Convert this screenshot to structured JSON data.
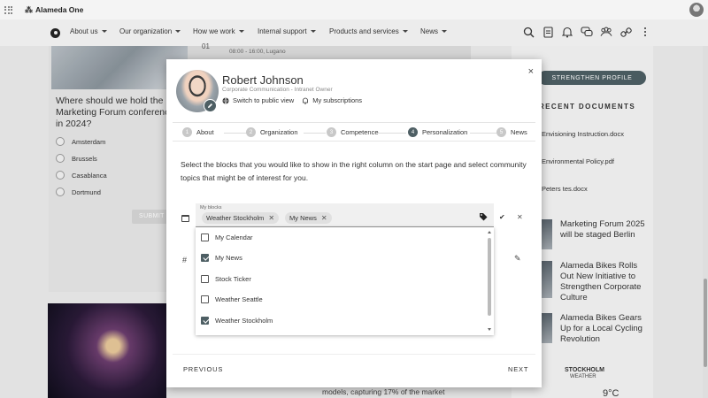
{
  "app": {
    "brand": "Alameda One"
  },
  "nav": {
    "items": [
      {
        "label": "About us"
      },
      {
        "label": "Our organization"
      },
      {
        "label": "How we work"
      },
      {
        "label": "Internal support"
      },
      {
        "label": "Products and services"
      },
      {
        "label": "News"
      }
    ],
    "icons": [
      "search-icon",
      "document-icon",
      "bell-icon",
      "chat-icon",
      "people-icon",
      "link-icon",
      "more-icon"
    ]
  },
  "background": {
    "poll_question": "Where should we hold the Marketing Forum conference in 2024?",
    "poll_options": [
      "Amsterdam",
      "Brussels",
      "Casablanca",
      "Dortmund"
    ],
    "poll_submit": "SUBMIT",
    "event_date": "01",
    "event_time": "08:00 - 16:00, Lugano",
    "center_text": "models, capturing 17% of the market",
    "strengthen_profile": "STRENGTHEN PROFILE",
    "recent_documents_title": "RECENT DOCUMENTS",
    "recent_documents": [
      "Envisioning Instruction.docx",
      "Environmental Policy.pdf",
      "Peters tes.docx"
    ],
    "news": [
      "Marketing Forum 2025 will be staged Berlin",
      "Alameda Bikes Rolls Out New Initiative to Strengthen Corporate Culture",
      "Alameda Bikes Gears Up for a Local Cycling Revolution"
    ],
    "weather_city": "STOCKHOLM",
    "weather_label": "WEATHER",
    "weather_temp": "9°C"
  },
  "modal": {
    "close_label": "×",
    "name": "Robert Johnson",
    "role": "Corporate Communication - Intranet Owner",
    "switch_view": "Switch to public view",
    "subscriptions": "My subscriptions",
    "steps": [
      {
        "num": "1",
        "label": "About"
      },
      {
        "num": "2",
        "label": "Organization"
      },
      {
        "num": "3",
        "label": "Competence"
      },
      {
        "num": "4",
        "label": "Personalization"
      },
      {
        "num": "5",
        "label": "News"
      }
    ],
    "instructions": "Select the blocks that you would like to show in the right column on the start page and select community topics that might be of interest for you.",
    "blocks_field_label": "My blocks",
    "chips": [
      "Weather Stockholm",
      "My News"
    ],
    "dropdown_options": [
      {
        "label": "My Calendar",
        "checked": false
      },
      {
        "label": "My News",
        "checked": true
      },
      {
        "label": "Stock Ticker",
        "checked": false
      },
      {
        "label": "Weather Seattle",
        "checked": false
      },
      {
        "label": "Weather Stockholm",
        "checked": true
      }
    ],
    "previous_label": "PREVIOUS",
    "next_label": "NEXT"
  },
  "colors": {
    "accent": "#4e5f64"
  }
}
